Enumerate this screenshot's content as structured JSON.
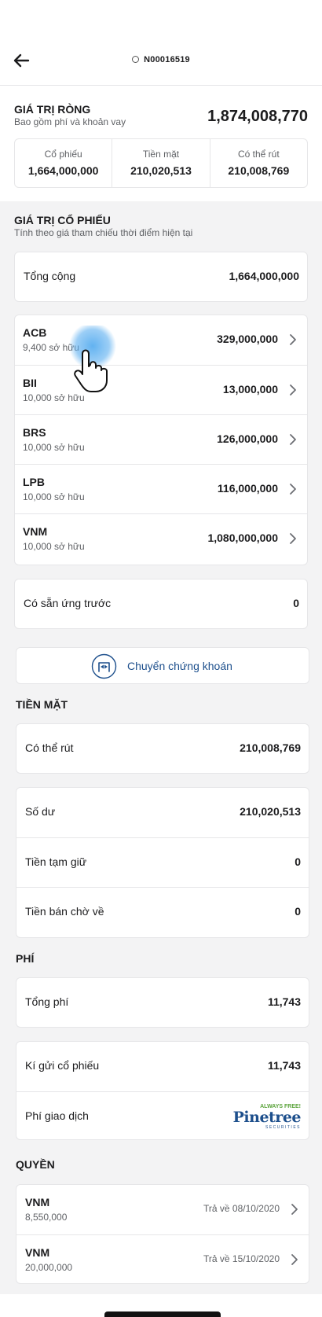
{
  "header": {
    "account_id": "N00016519"
  },
  "net_value": {
    "title": "GIÁ TRỊ RÒNG",
    "subtitle": "Bao gồm phí và khoản vay",
    "value": "1,874,008,770",
    "breakdown": [
      {
        "label": "Cổ phiếu",
        "value": "1,664,000,000"
      },
      {
        "label": "Tiền mặt",
        "value": "210,020,513"
      },
      {
        "label": "Có thể rút",
        "value": "210,008,769"
      }
    ]
  },
  "stock_value": {
    "title": "GIÁ TRỊ CỔ PHIẾU",
    "subtitle": "Tính theo giá tham chiếu thời điểm hiện tại",
    "total_label": "Tổng cộng",
    "total_value": "1,664,000,000",
    "holdings": [
      {
        "symbol": "ACB",
        "owned": "9,400 sở hữu",
        "value": "329,000,000"
      },
      {
        "symbol": "BII",
        "owned": "10,000 sở hữu",
        "value": "13,000,000"
      },
      {
        "symbol": "BRS",
        "owned": "10,000 sở hữu",
        "value": "126,000,000"
      },
      {
        "symbol": "LPB",
        "owned": "10,000 sở hữu",
        "value": "116,000,000"
      },
      {
        "symbol": "VNM",
        "owned": "10,000 sở hữu",
        "value": "1,080,000,000"
      }
    ],
    "advance_label": "Có sẵn ứng trước",
    "advance_value": "0",
    "transfer_label": "Chuyển chứng khoán"
  },
  "cash": {
    "title": "TIỀN MẶT",
    "withdrawable_label": "Có thể rút",
    "withdrawable_value": "210,008,769",
    "rows": [
      {
        "label": "Số dư",
        "value": "210,020,513"
      },
      {
        "label": "Tiền tạm giữ",
        "value": "0"
      },
      {
        "label": "Tiền bán chờ về",
        "value": "0"
      }
    ]
  },
  "fees": {
    "title": "PHÍ",
    "total_label": "Tổng phí",
    "total_value": "11,743",
    "deposit_label": "Kí gửi cổ phiếu",
    "deposit_value": "11,743",
    "trading_label": "Phí giao dịch",
    "logo": {
      "tagline": "ALWAYS FREE!",
      "brand": "Pinetree",
      "sub": "SECURITIES"
    }
  },
  "rights": {
    "title": "QUYỀN",
    "items": [
      {
        "symbol": "VNM",
        "quantity": "8,550,000",
        "date": "Trả về 08/10/2020"
      },
      {
        "symbol": "VNM",
        "quantity": "20,000,000",
        "date": "Trả về 15/10/2020"
      }
    ]
  },
  "colors": {
    "accent": "#1d4f8c",
    "logo_green": "#5aa33a",
    "logo_blue": "#1d4f8c",
    "touch": "#5aaef0"
  }
}
